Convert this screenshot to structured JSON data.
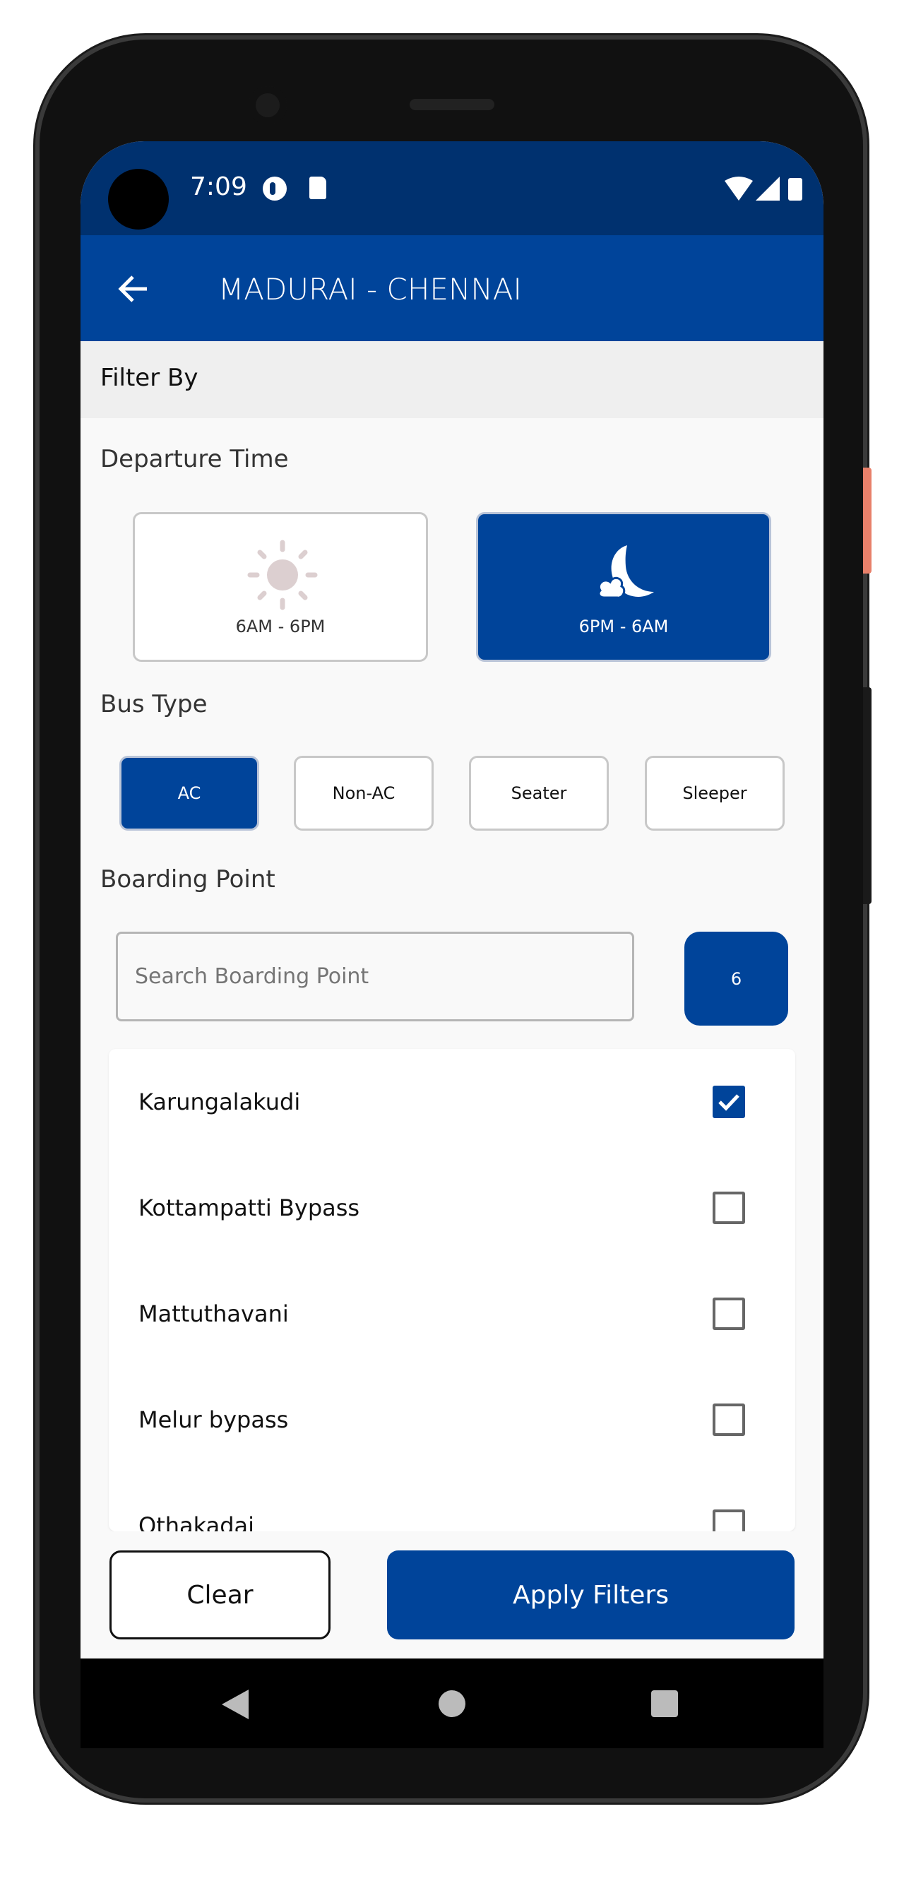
{
  "status_bar": {
    "time": "7:09",
    "icons": [
      "app-notification-icon",
      "sd-card-icon",
      "wifi-icon",
      "signal-icon",
      "battery-icon"
    ]
  },
  "app_bar": {
    "title": "MADURAI - CHENNAI",
    "back_icon": "arrow-left-icon"
  },
  "filter_header": "Filter By",
  "departure": {
    "label": "Departure Time",
    "options": [
      {
        "label": "6AM - 6PM",
        "icon": "sun-icon",
        "selected": false
      },
      {
        "label": "6PM - 6AM",
        "icon": "moon-icon",
        "selected": true
      }
    ]
  },
  "bus_type": {
    "label": "Bus Type",
    "options": [
      {
        "label": "AC",
        "selected": true
      },
      {
        "label": "Non-AC",
        "selected": false
      },
      {
        "label": "Seater",
        "selected": false
      },
      {
        "label": "Sleeper",
        "selected": false
      }
    ]
  },
  "boarding": {
    "label": "Boarding Point",
    "search_placeholder": "Search Boarding Point",
    "count": "6",
    "items": [
      {
        "label": "Karungalakudi",
        "checked": true
      },
      {
        "label": "Kottampatti Bypass",
        "checked": false
      },
      {
        "label": "Mattuthavani",
        "checked": false
      },
      {
        "label": "Melur bypass",
        "checked": false
      },
      {
        "label": "Othakadai",
        "checked": false
      }
    ]
  },
  "actions": {
    "clear": "Clear",
    "apply": "Apply Filters"
  },
  "colors": {
    "primary": "#00449a",
    "status_bar": "#00316f"
  }
}
